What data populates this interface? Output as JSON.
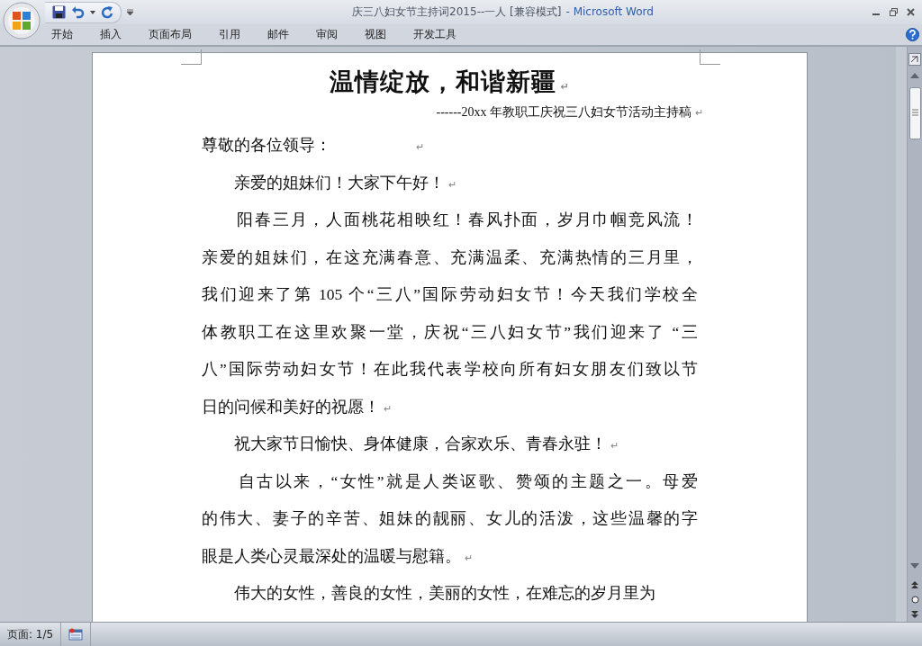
{
  "window": {
    "title": "庆三八妇女节主持词2015--一人 [兼容模式]",
    "app_name": "- Microsoft Word"
  },
  "ribbon_tabs": [
    {
      "label": "开始",
      "selected": false
    },
    {
      "label": "插入",
      "selected": false
    },
    {
      "label": "页面布局",
      "selected": false
    },
    {
      "label": "引用",
      "selected": false
    },
    {
      "label": "邮件",
      "selected": false
    },
    {
      "label": "审阅",
      "selected": false
    },
    {
      "label": "视图",
      "selected": false
    },
    {
      "label": "开发工具",
      "selected": false
    }
  ],
  "document": {
    "heading": "温情绽放，和谐新疆",
    "heading_mark": "↵",
    "subtitle": "------20xx 年教职工庆祝三八妇女节活动主持稿",
    "subtitle_mark": "↵",
    "paragraphs": [
      {
        "lines": [
          "尊敬的各位领导：　　　　　"
        ],
        "mark": "↵"
      },
      {
        "lines": [
          "　　亲爱的姐妹们！大家下午好！"
        ],
        "mark": "↵"
      },
      {
        "lines": [
          "　　阳春三月，人面桃花相映红！春风扑面，岁月巾帼竞风流！",
          "亲爱的姐妹们，在这充满春意、充满温柔、充满热情的三月里，",
          "我们迎来了第 105 个“三八”国际劳动妇女节！今天我们学校全",
          "体教职工在这里欢聚一堂，庆祝“三八妇女节”我们迎来了 “三",
          "八”国际劳动妇女节！在此我代表学校向所有妇女朋友们致以节",
          "日的问候和美好的祝愿！"
        ],
        "mark": "↵"
      },
      {
        "lines": [
          "　　祝大家节日愉快、身体健康，合家欢乐、青春永驻！"
        ],
        "mark": "↵"
      },
      {
        "lines": [
          "　　自古以来，“女性”就是人类讴歌、赞颂的主题之一。母爱",
          "的伟大、妻子的辛苦、姐妹的靓丽、女儿的活泼，这些温馨的字",
          "眼是人类心灵最深处的温暖与慰籍。"
        ],
        "mark": "↵"
      },
      {
        "lines": [
          "　　伟大的女性，善良的女性，美丽的女性，在难忘的岁月里为"
        ]
      }
    ]
  },
  "status_bar": {
    "page": "页面: 1/5"
  }
}
